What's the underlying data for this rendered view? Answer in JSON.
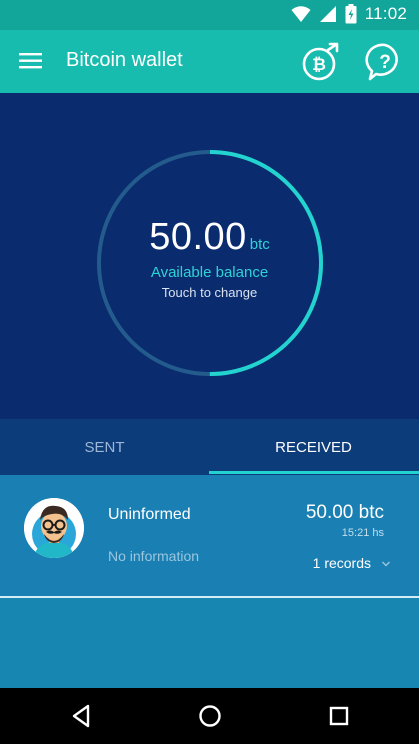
{
  "status_bar": {
    "time": "11:02"
  },
  "app_bar": {
    "title": "Bitcoin wallet",
    "menu_icon": "hamburger-menu-icon",
    "bitcoin_icon": "bitcoin-transfer-icon",
    "help_icon": "help-question-icon"
  },
  "balance": {
    "amount": "50.00",
    "unit": "btc",
    "label": "Available balance",
    "hint": "Touch to change",
    "ring_progress": 0.5
  },
  "tabs": [
    {
      "label": "SENT",
      "active": false
    },
    {
      "label": "RECEIVED",
      "active": true
    }
  ],
  "records": [
    {
      "name": "Uninformed",
      "info": "No information",
      "amount": "50.00 btc",
      "time": "15:21 hs",
      "count": "1 records"
    }
  ],
  "colors": {
    "status_bar": "#12a59a",
    "app_bar": "#18bcae",
    "balance_bg": "#0a2b6e",
    "accent": "#22d3cf",
    "tabs_bg": "#0d3c7a",
    "list_bg": "#1786b0"
  }
}
